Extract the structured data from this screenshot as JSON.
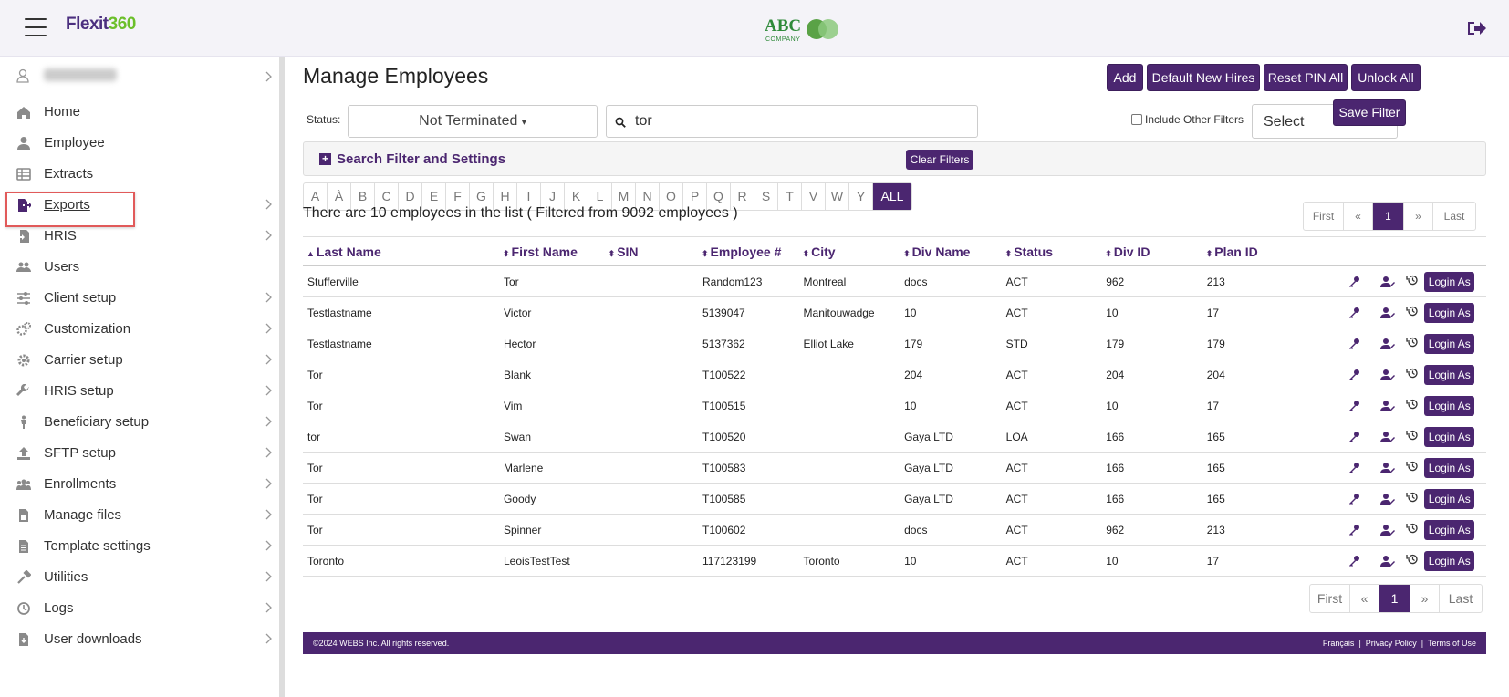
{
  "topbar": {
    "logo_part1": "Flexit",
    "logo_part2": "360",
    "abc_text": "ABC",
    "abc_sub": "COMPANY"
  },
  "sidebar": {
    "items": [
      {
        "label": "Home",
        "icon": "home-icon",
        "chevron": false
      },
      {
        "label": "Employee",
        "icon": "user-icon",
        "chevron": false
      },
      {
        "label": "Extracts",
        "icon": "table-icon",
        "chevron": false
      },
      {
        "label": "Exports",
        "icon": "export-icon",
        "chevron": true
      },
      {
        "label": "HRIS",
        "icon": "file-import-icon",
        "chevron": true
      },
      {
        "label": "Users",
        "icon": "users-icon",
        "chevron": false
      },
      {
        "label": "Client setup",
        "icon": "sliders-icon",
        "chevron": true
      },
      {
        "label": "Customization",
        "icon": "cogs-icon",
        "chevron": true
      },
      {
        "label": "Carrier setup",
        "icon": "gear-icon",
        "chevron": true
      },
      {
        "label": "HRIS setup",
        "icon": "wrench-icon",
        "chevron": true
      },
      {
        "label": "Beneficiary setup",
        "icon": "person-icon",
        "chevron": true
      },
      {
        "label": "SFTP setup",
        "icon": "upload-icon",
        "chevron": true
      },
      {
        "label": "Enrollments",
        "icon": "group-icon",
        "chevron": true
      },
      {
        "label": "Manage files",
        "icon": "file-icon",
        "chevron": true
      },
      {
        "label": "Template settings",
        "icon": "file-alt-icon",
        "chevron": true
      },
      {
        "label": "Utilities",
        "icon": "tools-icon",
        "chevron": true
      },
      {
        "label": "Logs",
        "icon": "history-icon",
        "chevron": true
      },
      {
        "label": "User downloads",
        "icon": "download-file-icon",
        "chevron": true
      }
    ]
  },
  "main": {
    "title": "Manage Employees",
    "buttons": {
      "add": "Add",
      "default_new_hires": "Default New Hires",
      "reset_pin_all": "Reset PIN All",
      "unlock_all": "Unlock All",
      "save_filter": "Save Filter"
    },
    "status_label": "Status:",
    "status_value": "Not Terminated",
    "search_value": "tor",
    "include_other_filters": "Include Other Filters",
    "select_value": "Select",
    "search_filter_label": "Search Filter and Settings",
    "clear_filters": "Clear Filters",
    "alphabet": [
      "A",
      "À",
      "B",
      "C",
      "D",
      "E",
      "F",
      "G",
      "H",
      "I",
      "J",
      "K",
      "L",
      "M",
      "N",
      "O",
      "P",
      "Q",
      "R",
      "S",
      "T",
      "V",
      "W",
      "Y",
      "ALL"
    ],
    "count_text": "There are 10 employees in the list ( Filtered from 9092 employees )",
    "pager": {
      "first": "First",
      "prev": "«",
      "current": "1",
      "next": "»",
      "last": "Last"
    },
    "columns": [
      "Last Name",
      "First Name",
      "SIN",
      "Employee #",
      "City",
      "Div Name",
      "Status",
      "Div ID",
      "Plan ID"
    ],
    "rows": [
      {
        "last": "Stufferville",
        "first": "Tor",
        "sin": "",
        "emp": "Random123",
        "city": "Montreal",
        "div": "docs",
        "status": "ACT",
        "divid": "962",
        "plan": "213"
      },
      {
        "last": "Testlastname",
        "first": "Victor",
        "sin": "",
        "emp": "5139047",
        "city": "Manitouwadge",
        "div": "10",
        "status": "ACT",
        "divid": "10",
        "plan": "17"
      },
      {
        "last": "Testlastname",
        "first": "Hector",
        "sin": "",
        "emp": "5137362",
        "city": "Elliot Lake",
        "div": "179",
        "status": "STD",
        "divid": "179",
        "plan": "179"
      },
      {
        "last": "Tor",
        "first": "Blank",
        "sin": "",
        "emp": "T100522",
        "city": "",
        "div": "204",
        "status": "ACT",
        "divid": "204",
        "plan": "204"
      },
      {
        "last": "Tor",
        "first": "Vim",
        "sin": "",
        "emp": "T100515",
        "city": "",
        "div": "10",
        "status": "ACT",
        "divid": "10",
        "plan": "17"
      },
      {
        "last": "tor",
        "first": "Swan",
        "sin": "",
        "emp": "T100520",
        "city": "",
        "div": "Gaya LTD",
        "status": "LOA",
        "divid": "166",
        "plan": "165"
      },
      {
        "last": "Tor",
        "first": "Marlene",
        "sin": "",
        "emp": "T100583",
        "city": "",
        "div": "Gaya LTD",
        "status": "ACT",
        "divid": "166",
        "plan": "165"
      },
      {
        "last": "Tor",
        "first": "Goody",
        "sin": "",
        "emp": "T100585",
        "city": "",
        "div": "Gaya LTD",
        "status": "ACT",
        "divid": "166",
        "plan": "165"
      },
      {
        "last": "Tor",
        "first": "Spinner",
        "sin": "",
        "emp": "T100602",
        "city": "",
        "div": "docs",
        "status": "ACT",
        "divid": "962",
        "plan": "213"
      },
      {
        "last": "Toronto",
        "first": "LeoisTestTest",
        "sin": "",
        "emp": "117123199",
        "city": "Toronto",
        "div": "10",
        "status": "ACT",
        "divid": "10",
        "plan": "17"
      }
    ],
    "login_as": "Login As",
    "footer": {
      "copyright": "©2024 WEBS Inc. All rights reserved.",
      "francais": "Français",
      "privacy": "Privacy Policy",
      "terms": "Terms of Use"
    }
  },
  "colors": {
    "brand": "#4b2670",
    "green": "#6bbf2a",
    "highlight": "#e15a5a"
  }
}
